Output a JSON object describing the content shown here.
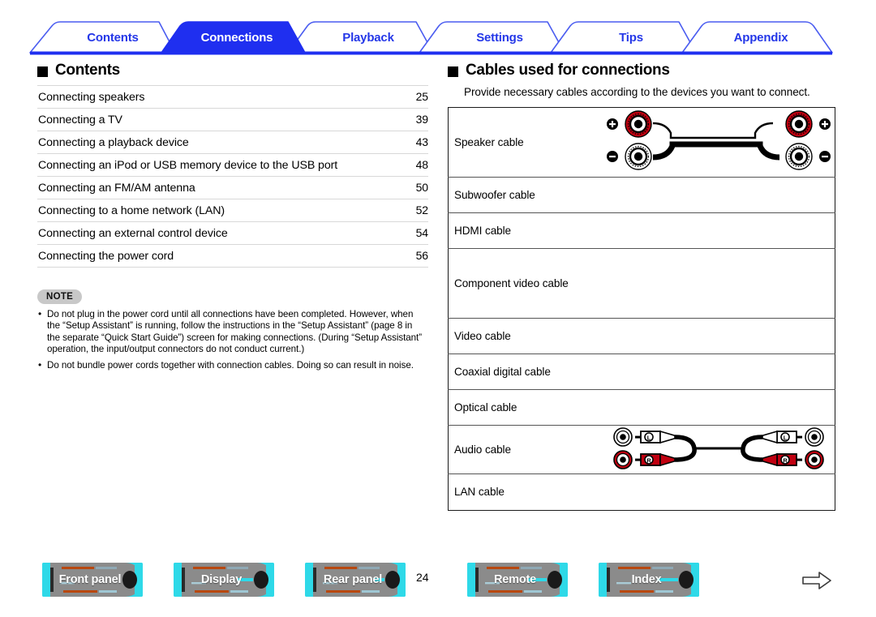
{
  "colors": {
    "brand_blue": "#2437e8",
    "tab_active_fill": "#1f2ff0",
    "note_badge_bg": "#c8c8c8",
    "nav_button_cyan": "#2ed9e8",
    "nav_button_gray": "#8b8b8b",
    "connector_red": "#c00010"
  },
  "tabs": [
    {
      "label": "Contents",
      "active": false,
      "name": "tab-contents"
    },
    {
      "label": "Connections",
      "active": true,
      "name": "tab-connections"
    },
    {
      "label": "Playback",
      "active": false,
      "name": "tab-playback"
    },
    {
      "label": "Settings",
      "active": false,
      "name": "tab-settings"
    },
    {
      "label": "Tips",
      "active": false,
      "name": "tab-tips"
    },
    {
      "label": "Appendix",
      "active": false,
      "name": "tab-appendix"
    }
  ],
  "left": {
    "heading": "Contents",
    "toc": [
      {
        "title": "Connecting speakers",
        "page": "25"
      },
      {
        "title": "Connecting a TV",
        "page": "39"
      },
      {
        "title": "Connecting a playback device",
        "page": "43"
      },
      {
        "title": "Connecting an iPod or USB memory device to the USB port",
        "page": "48"
      },
      {
        "title": "Connecting an FM/AM antenna",
        "page": "50"
      },
      {
        "title": "Connecting to a home network (LAN)",
        "page": "52"
      },
      {
        "title": "Connecting an external control device",
        "page": "54"
      },
      {
        "title": "Connecting the power cord",
        "page": "56"
      }
    ],
    "note": {
      "badge": "NOTE",
      "items": [
        "Do not plug in the power cord until all connections have been completed. However, when the “Setup Assistant” is running, follow the instructions in the “Setup Assistant” (page 8 in the separate “Quick Start Guide”) screen for making connections. (During “Setup Assistant” operation, the input/output connectors do not conduct current.)",
        "Do not bundle power cords together with connection cables. Doing so can result in noise."
      ]
    }
  },
  "right": {
    "heading": "Cables used for connections",
    "intro": "Provide necessary cables according to the devices you want to connect.",
    "table": {
      "rows": [
        {
          "label": "Speaker cable",
          "diagram": "speaker-cable-diagram"
        },
        {
          "label": "Subwoofer cable",
          "diagram": ""
        },
        {
          "label": "HDMI cable",
          "diagram": ""
        },
        {
          "label": "Component video cable",
          "diagram": ""
        },
        {
          "label": "Video cable",
          "diagram": ""
        },
        {
          "label": "Coaxial digital cable",
          "diagram": ""
        },
        {
          "label": "Optical cable",
          "diagram": ""
        },
        {
          "label": "Audio cable",
          "diagram": "audio-cable-diagram"
        },
        {
          "label": "LAN cable",
          "diagram": ""
        }
      ]
    },
    "diagram_labels": {
      "speaker_plus": "+",
      "speaker_minus": "–",
      "audio_left": "L",
      "audio_right": "R"
    }
  },
  "footer": {
    "buttons": [
      {
        "label": "Front panel",
        "name": "nav-front-panel"
      },
      {
        "label": "Display",
        "name": "nav-display"
      },
      {
        "label": "Rear panel",
        "name": "nav-rear-panel"
      },
      {
        "label": "Remote",
        "name": "nav-remote"
      },
      {
        "label": "Index",
        "name": "nav-index"
      }
    ],
    "page_number": "24",
    "next_icon": "arrow-right-icon"
  }
}
